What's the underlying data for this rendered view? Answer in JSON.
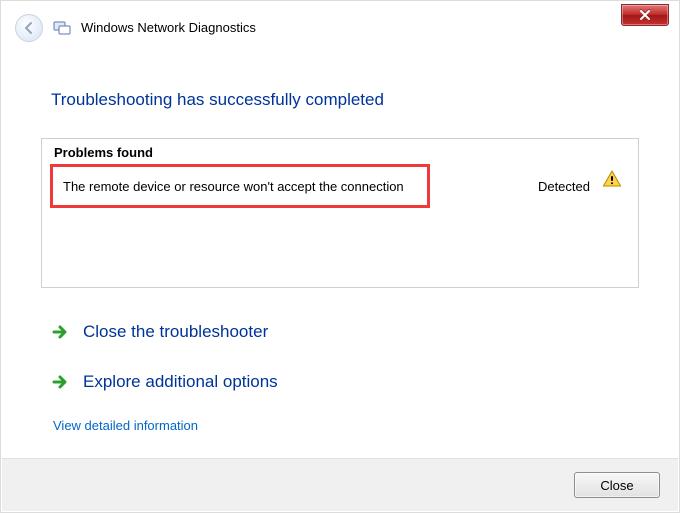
{
  "header": {
    "title": "Windows Network Diagnostics"
  },
  "heading": "Troubleshooting has successfully completed",
  "problems": {
    "section_label": "Problems found",
    "items": [
      {
        "description": "The remote device or resource won't accept the connection",
        "status": "Detected"
      }
    ]
  },
  "options": {
    "close_troubleshooter": "Close the troubleshooter",
    "explore_more": "Explore additional options"
  },
  "links": {
    "view_details": "View detailed information"
  },
  "footer": {
    "close_label": "Close"
  }
}
